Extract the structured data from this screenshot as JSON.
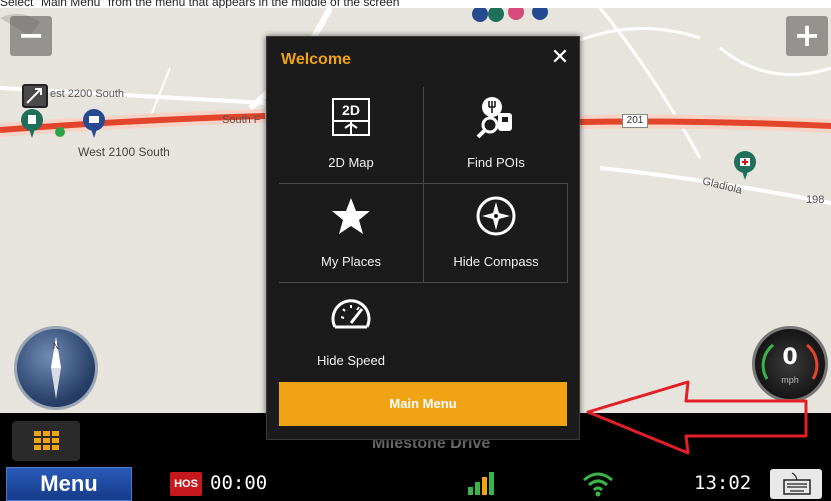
{
  "caption": "Select \"Main Menu\" from the menu that appears in the middle of the screen",
  "map": {
    "zoom_out_label": "−",
    "zoom_in_label": "+",
    "street_labels": [
      "est 2200 South",
      "South F",
      "West 2100 South",
      "Gladiola",
      "198"
    ],
    "route_shield": "201",
    "speed_value": "0",
    "speed_unit": "mph",
    "compass_letter": "N"
  },
  "dialog": {
    "title": "Welcome",
    "close_label": "✕",
    "tiles": [
      {
        "label": "2D Map",
        "icon": "map-2d-icon",
        "icon_text": "2D"
      },
      {
        "label": "Find POIs",
        "icon": "find-poi-icon"
      },
      {
        "label": "My Places",
        "icon": "star-icon"
      },
      {
        "label": "Hide Compass",
        "icon": "compass-icon"
      },
      {
        "label": "Hide Speed",
        "icon": "speedometer-icon"
      }
    ],
    "main_menu_label": "Main Menu"
  },
  "bottom": {
    "street_name": "Milestone Drive"
  },
  "statusbar": {
    "menu_label": "Menu",
    "hos_badge": "HOS",
    "hos_time": "00:00",
    "clock": "13:02"
  },
  "colors": {
    "accent": "#f0a313",
    "menu_blue": "#1e4aa3",
    "hos_red": "#c7181d",
    "arrow_red": "#e21f26",
    "route_red": "#e2452b"
  }
}
